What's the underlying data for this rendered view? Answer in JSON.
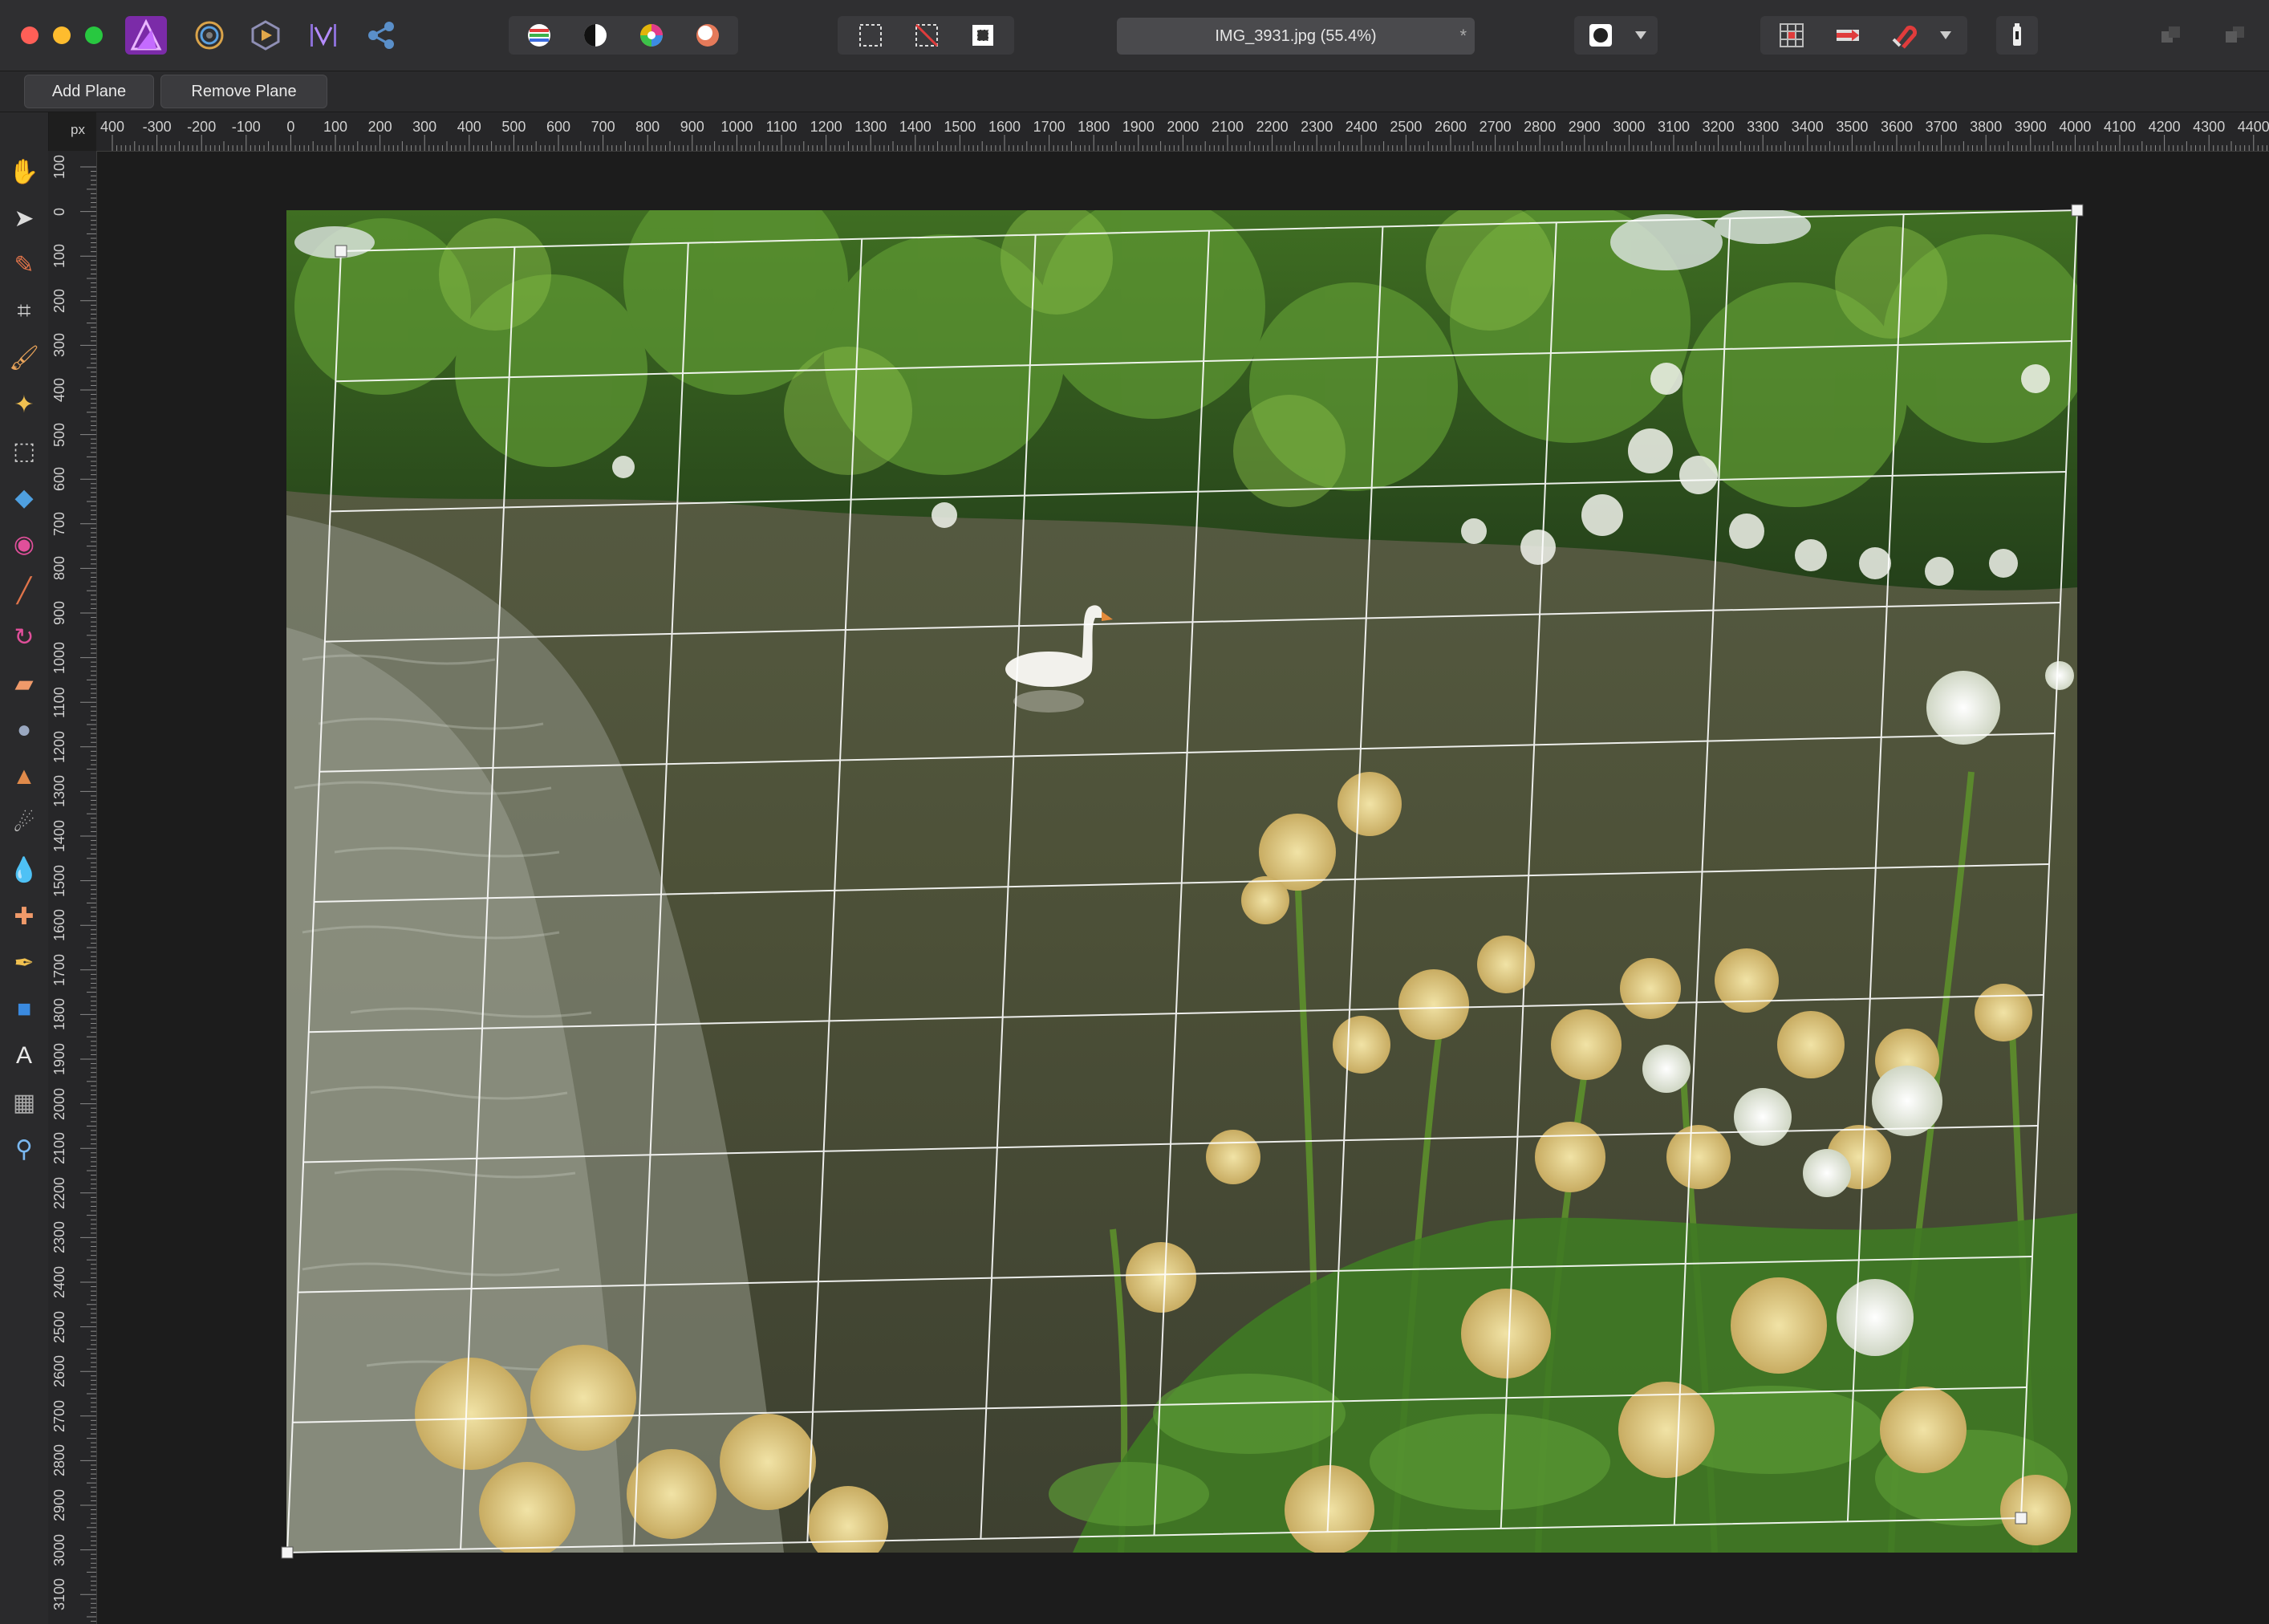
{
  "window": {
    "traffic_lights": {
      "close": "#ff5f57",
      "minimize": "#febc2e",
      "maximize": "#28c840"
    }
  },
  "toolbar": {
    "personas": [
      {
        "name": "photo-persona",
        "icon": "affinity-photo-icon"
      },
      {
        "name": "liquify-persona",
        "icon": "liquify-icon"
      },
      {
        "name": "develop-persona",
        "icon": "develop-icon"
      },
      {
        "name": "tone-mapping-persona",
        "icon": "tone-mapping-icon"
      },
      {
        "name": "export-persona",
        "icon": "export-icon"
      }
    ],
    "document_tab": {
      "title": "IMG_3931.jpg (55.4%)",
      "close_glyph": "*"
    }
  },
  "context_bar": {
    "add_plane_label": "Add Plane",
    "remove_plane_label": "Remove Plane"
  },
  "rulers": {
    "unit": "px",
    "horizontal_labels": [
      "400",
      "-300",
      "-200",
      "-100",
      "0",
      "100",
      "200",
      "300",
      "400",
      "500",
      "600",
      "700",
      "800",
      "900",
      "1000",
      "1100",
      "1200",
      "1300",
      "1400",
      "1500",
      "1600",
      "1700",
      "1800",
      "1900",
      "2000",
      "2100",
      "2200",
      "2300",
      "2400",
      "2500",
      "2600",
      "2700",
      "2800",
      "2900",
      "3000",
      "3100",
      "3200",
      "3300",
      "3400",
      "3500",
      "3600",
      "3700",
      "3800",
      "3900",
      "4000",
      "4100",
      "4200",
      "4300",
      "4400"
    ],
    "vertical_labels": [
      "100",
      "0",
      "100",
      "200",
      "300",
      "400",
      "500",
      "600",
      "700",
      "800",
      "900",
      "1000",
      "1100",
      "1200",
      "1300",
      "1400",
      "1500",
      "1600",
      "1700",
      "1800",
      "1900",
      "2000",
      "2100",
      "2200",
      "2300",
      "2400",
      "2500",
      "2600",
      "2700",
      "2800",
      "2900",
      "3000",
      "3100"
    ]
  },
  "tools": [
    "hand-tool-icon",
    "move-tool-icon",
    "color-picker-icon",
    "crop-tool-icon",
    "paint-brush-icon",
    "magic-wand-icon",
    "marquee-select-icon",
    "flood-fill-icon",
    "color-wheel-icon",
    "brush-tool-icon",
    "selection-brush-icon",
    "eraser-icon",
    "dodge-burn-icon",
    "clone-stamp-icon",
    "smudge-icon",
    "blur-tool-icon",
    "healing-brush-icon",
    "pen-tool-icon",
    "rectangle-tool-icon",
    "text-tool-icon",
    "mesh-warp-icon",
    "zoom-tool-icon"
  ],
  "colors": {
    "accent": "#a53de0",
    "ui_dark": "#2f2f31",
    "grid_line": "#ffffff"
  }
}
